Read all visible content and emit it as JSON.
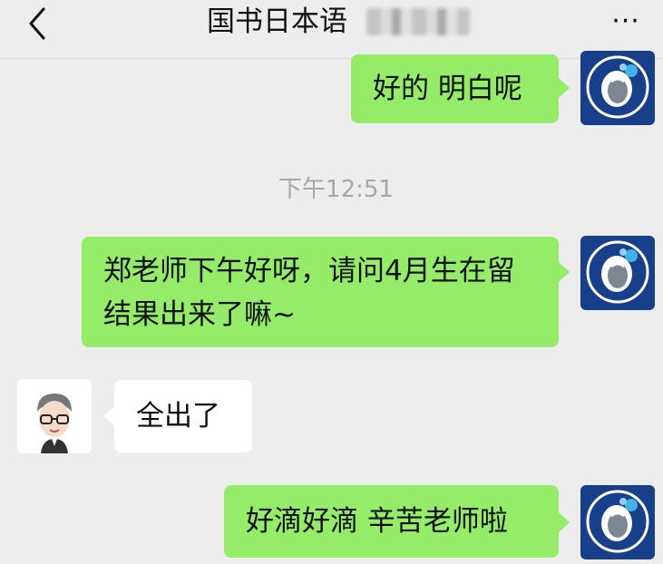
{
  "header": {
    "title": "国书日本语",
    "more_label": "···"
  },
  "messages": [
    {
      "side": "right",
      "text": "好的 明白呢"
    },
    {
      "side": "right",
      "text": "郑老师下午好呀，请问4月生在留结果出来了嘛~"
    },
    {
      "side": "left",
      "text": "全出了"
    },
    {
      "side": "right",
      "text": "好滴好滴 辛苦老师啦"
    }
  ],
  "timestamp": "下午12:51",
  "colors": {
    "outgoing_bubble": "#95ec69",
    "incoming_bubble": "#ffffff",
    "background": "#ededed",
    "avatar_brand": "#173f8a"
  },
  "icons": {
    "back": "chevron-left-icon",
    "more": "more-dots-icon",
    "my_avatar": "whale-logo-icon",
    "teacher_avatar": "cartoon-man-avatar-icon"
  }
}
